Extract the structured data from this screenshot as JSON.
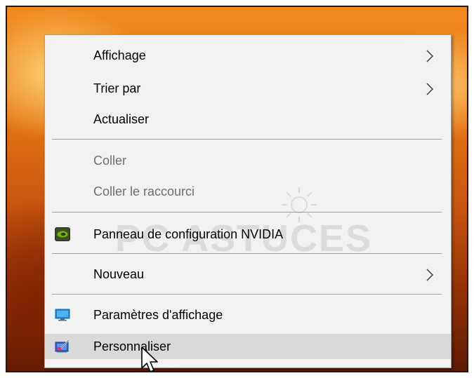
{
  "menu": {
    "items": [
      {
        "label": "Affichage",
        "submenu": true
      },
      {
        "label": "Trier par",
        "submenu": true
      },
      {
        "label": "Actualiser"
      },
      {
        "label": "Coller",
        "disabled": true
      },
      {
        "label": "Coller le raccourci",
        "disabled": true
      },
      {
        "label": "Panneau de configuration NVIDIA",
        "icon": "nvidia-icon"
      },
      {
        "label": "Nouveau",
        "submenu": true
      },
      {
        "label": "Paramètres d'affichage",
        "icon": "display-settings-icon"
      },
      {
        "label": "Personnaliser",
        "icon": "personalize-icon",
        "highlighted": true
      }
    ]
  },
  "watermark": {
    "text": "PC ASTUCES"
  },
  "colors": {
    "menu_bg": "#f2f2f2",
    "highlight": "#d9d9d9",
    "disabled_text": "#6d6d6d",
    "nvidia_green": "#76b900"
  }
}
